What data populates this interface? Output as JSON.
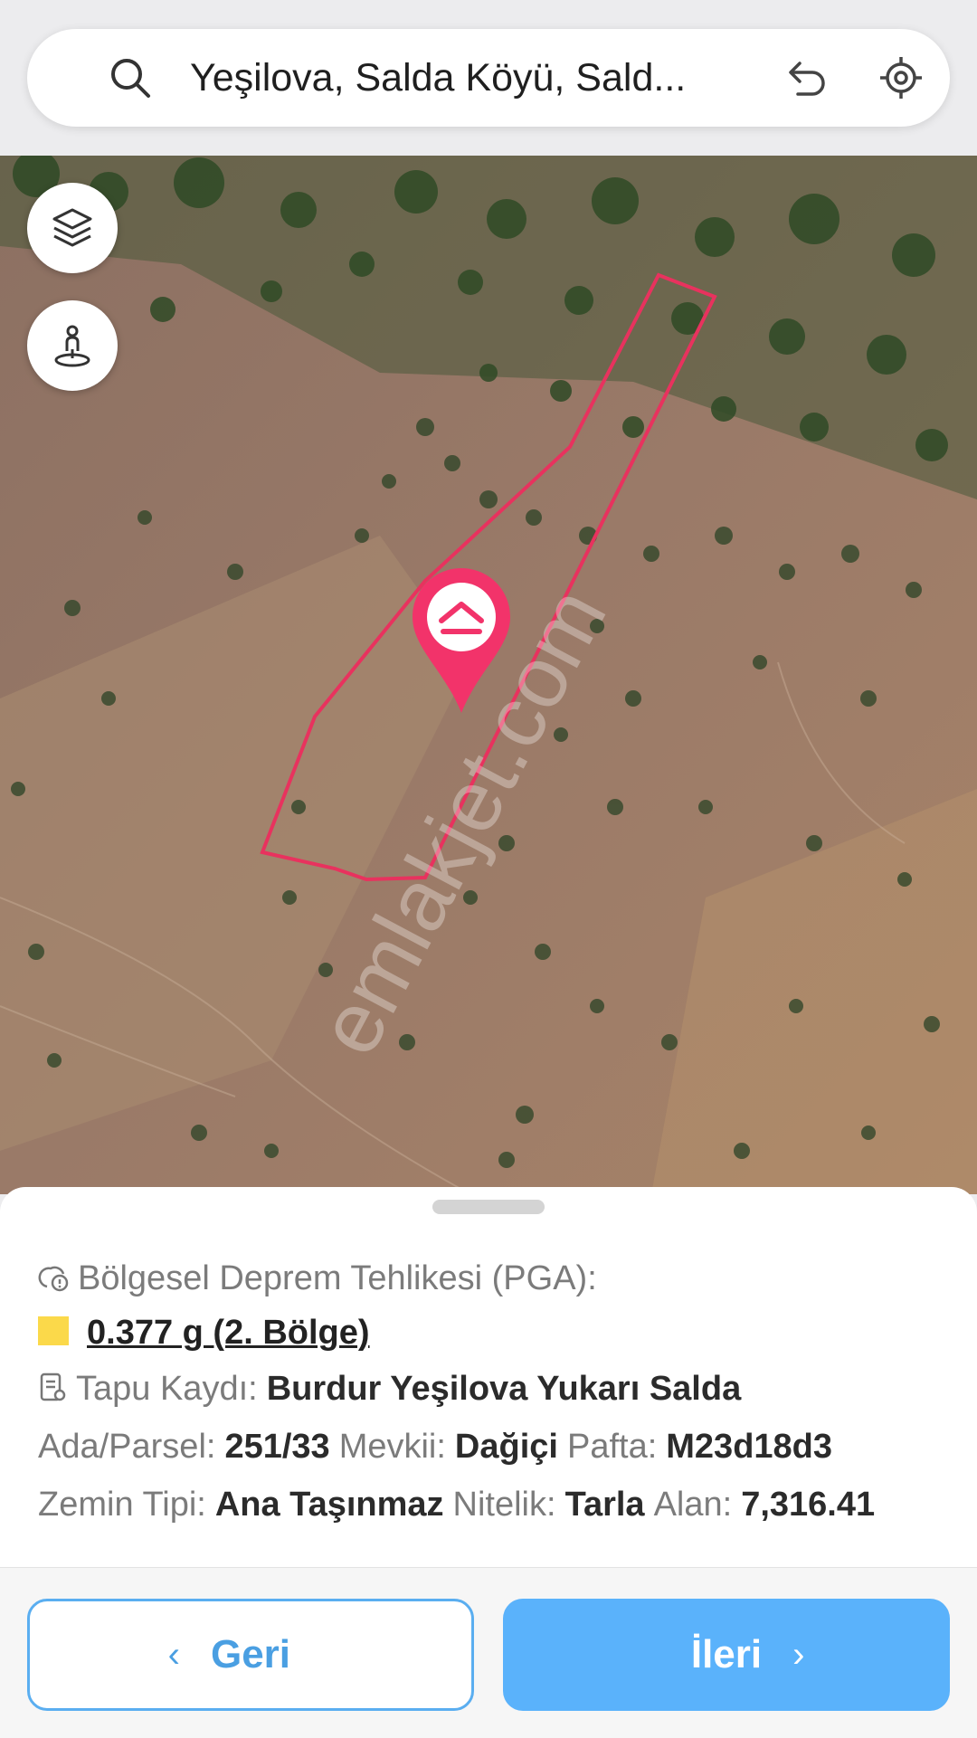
{
  "search": {
    "query": "Yeşilova, Salda Köyü, Sald...",
    "icons": [
      "search-icon",
      "undo-icon",
      "locate-icon"
    ]
  },
  "map": {
    "controls": [
      "layers-icon",
      "street-view-icon"
    ],
    "marker_icon": "home-pin-icon",
    "watermark": "emlakjet.com",
    "parcel_color": "#e8325e"
  },
  "info": {
    "pga_label": "Bölgesel Deprem Tehlikesi (PGA):",
    "pga_value": "0.377 g (2. Bölge)",
    "pga_color": "#fbd94a",
    "tapu_label": "Tapu Kaydı:",
    "tapu_value": "Burdur Yeşilova Yukarı Salda",
    "ada_label": "Ada/Parsel:",
    "ada_value": "251/33",
    "mevkii_label": "Mevkii:",
    "mevkii_value": "Dağiçi",
    "pafta_label": "Pafta:",
    "pafta_value": "M23d18d3",
    "zemin_label": "Zemin Tipi:",
    "zemin_value": "Ana Taşınmaz",
    "nitelik_label": "Nitelik:",
    "nitelik_value": "Tarla",
    "alan_label": "Alan:",
    "alan_value": "7,316.41"
  },
  "footer": {
    "back_label": "Geri",
    "next_label": "İleri",
    "accent": "#5ab2fb"
  }
}
